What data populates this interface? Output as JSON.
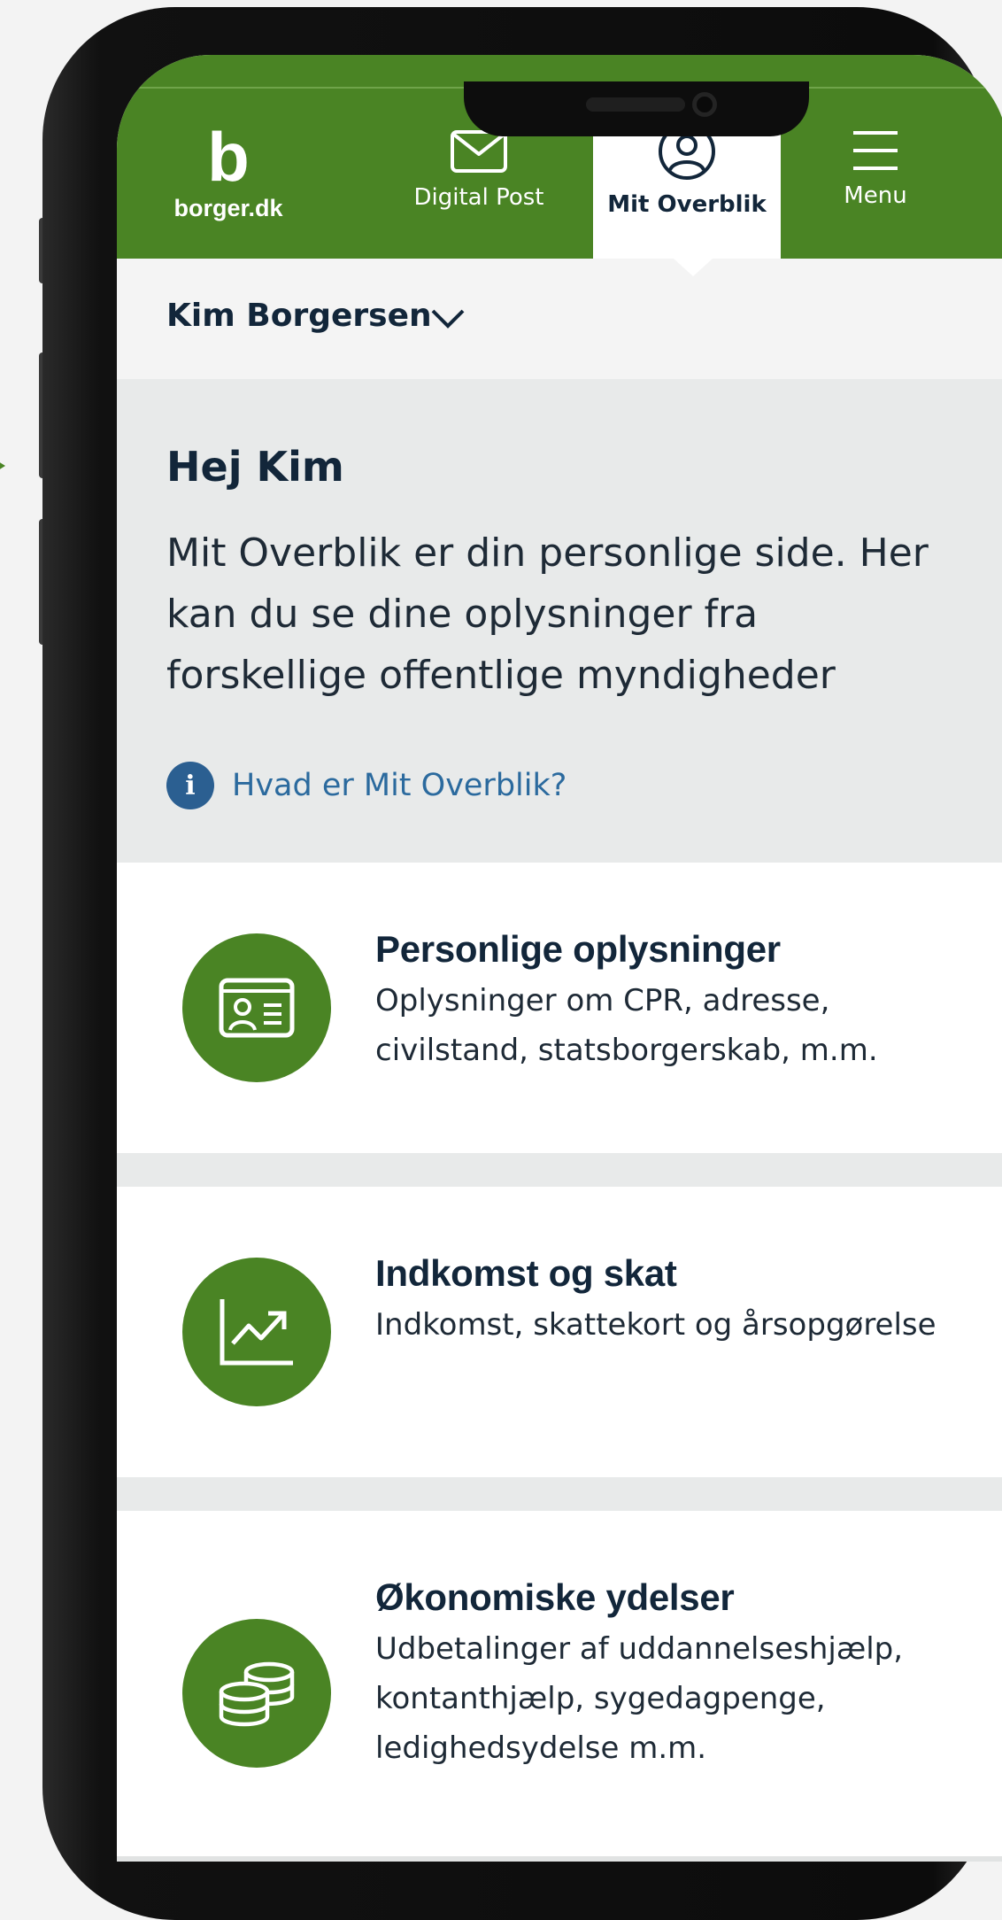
{
  "header": {
    "logo_letter": "b",
    "logo_text": "borger.dk",
    "nav": [
      {
        "label": "Digital Post",
        "icon": "envelope-icon"
      },
      {
        "label": "Mit Overblik",
        "icon": "user-circle-icon",
        "active": true
      },
      {
        "label": "Menu",
        "icon": "hamburger-menu-icon"
      }
    ]
  },
  "user": {
    "name": "Kim Borgersen",
    "dropdown_icon": "chevron-down-icon"
  },
  "intro": {
    "greeting": "Hej Kim",
    "text": "Mit Overblik er din personlige side. Her kan du se dine oplysninger fra forskellige offentlige myndigheder",
    "info_icon_letter": "i",
    "info_link": "Hvad er Mit Overblik?"
  },
  "cards": [
    {
      "title": "Personlige oplysninger",
      "description": "Oplysninger om CPR, adresse, civilstand, statsborgerskab, m.m.",
      "icon": "id-card-icon"
    },
    {
      "title": "Indkomst og skat",
      "description": "Indkomst, skattekort og årsopgørelse",
      "icon": "trend-chart-icon"
    },
    {
      "title": "Økonomiske ydelser",
      "description": "Udbetalinger af uddannelseshjælp, kontanthjælp, sygedagpenge, ledighedsydelse m.m.",
      "icon": "coins-icon"
    }
  ],
  "colors": {
    "brand_green": "#4a8424",
    "navy_text": "#12263a",
    "link_blue": "#2b6a9e",
    "intro_bg": "#e8eaea"
  }
}
